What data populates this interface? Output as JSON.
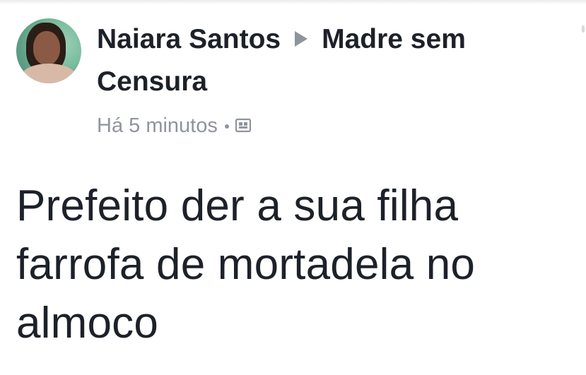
{
  "post": {
    "author": "Naiara Santos",
    "group": "Madre sem",
    "group_cont": "Censura",
    "timestamp": "Há 5 minutos",
    "privacy_icon": "group-audience-icon",
    "avatar_icon": "profile-photo",
    "separator_icon": "triangle-right-icon",
    "text_lines": [
      "Prefeito der a sua filha",
      "farrofa de mortadela no",
      "almoco"
    ]
  },
  "colors": {
    "text": "#1d2129",
    "meta": "#90949c",
    "background": "#ffffff"
  }
}
